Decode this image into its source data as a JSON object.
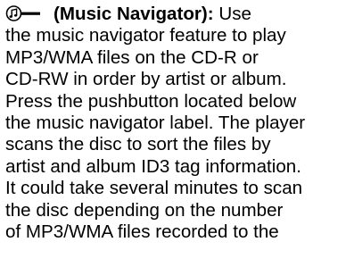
{
  "section": {
    "icon": "music-navigator-icon",
    "title": "(Music Navigator):",
    "first_line_text": " Use",
    "lines": [
      "the music navigator feature to play",
      "MP3/WMA files on the CD-R or",
      "CD-RW in order by artist or album.",
      "Press the pushbutton located below",
      "the music navigator label. The player",
      "scans the disc to sort the files by",
      "artist and album ID3 tag information.",
      "It could take several minutes to scan",
      "the disc depending on the number",
      "of MP3/WMA files recorded to the"
    ]
  }
}
